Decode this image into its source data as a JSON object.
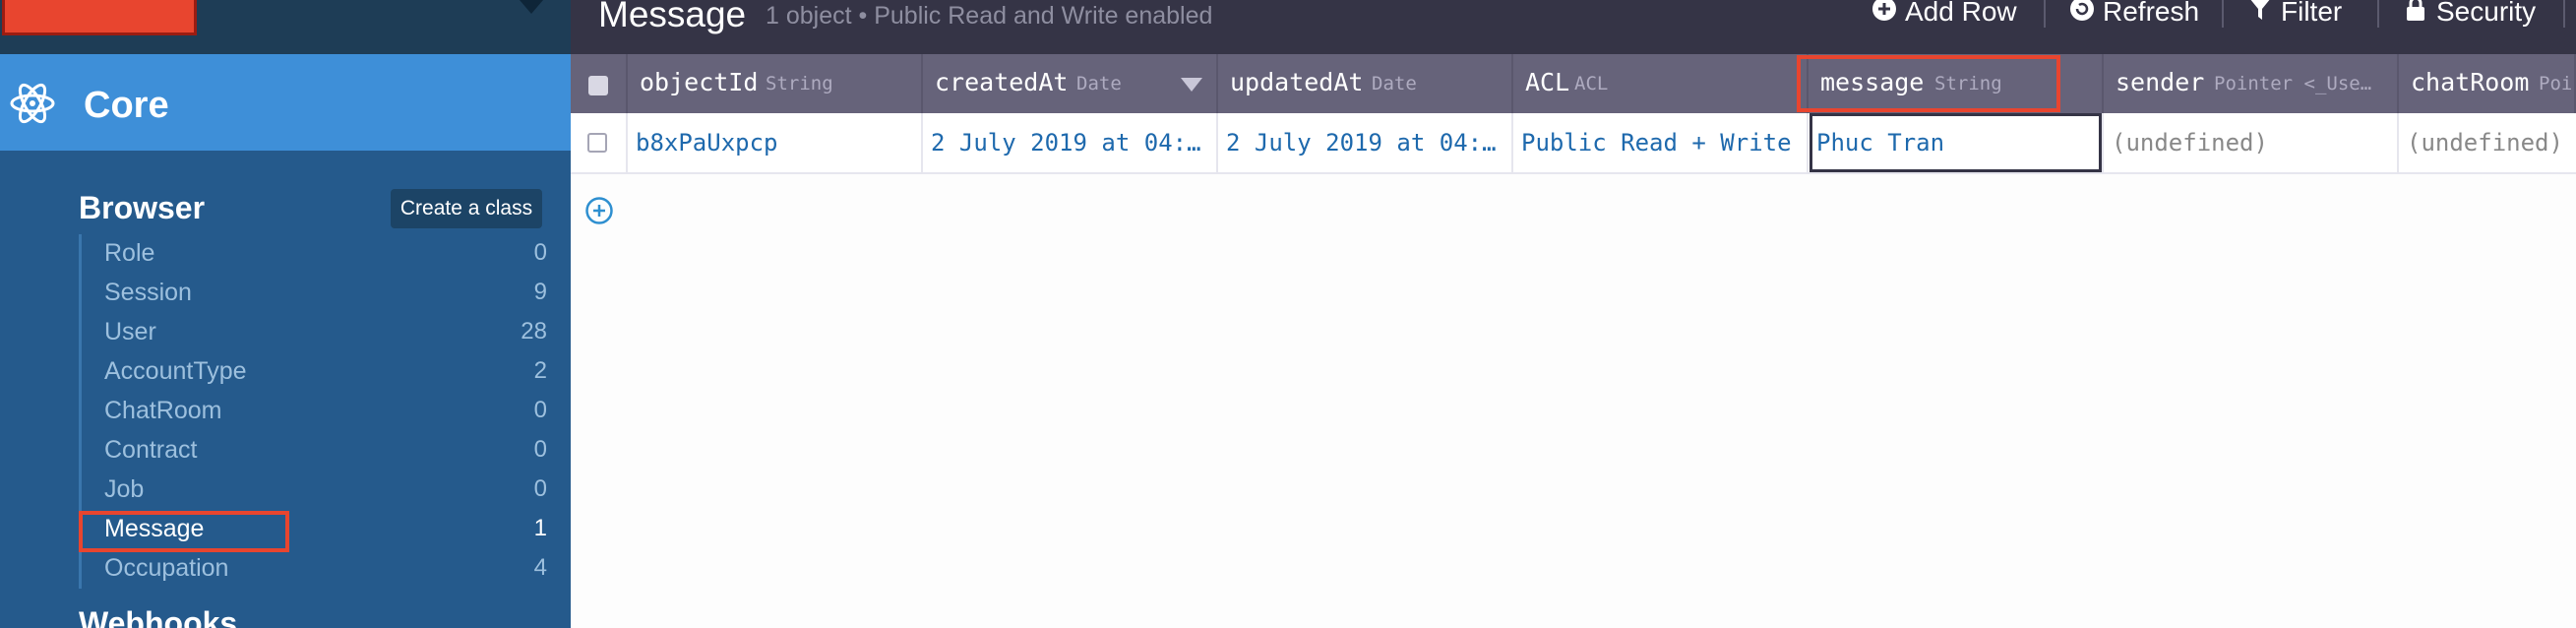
{
  "sidebar": {
    "section_title": "Core",
    "browser_title": "Browser",
    "create_class_label": "Create a class",
    "classes": [
      {
        "name": "Role",
        "count": "0"
      },
      {
        "name": "Session",
        "count": "9"
      },
      {
        "name": "User",
        "count": "28"
      },
      {
        "name": "AccountType",
        "count": "2"
      },
      {
        "name": "ChatRoom",
        "count": "0"
      },
      {
        "name": "Contract",
        "count": "0"
      },
      {
        "name": "Job",
        "count": "0"
      },
      {
        "name": "Message",
        "count": "1"
      },
      {
        "name": "Occupation",
        "count": "4"
      }
    ],
    "active_class": "Message",
    "next_section_title": "Webhooks"
  },
  "toolbar": {
    "title": "Message",
    "subtitle": "1 object • Public Read and Write enabled",
    "add_row_label": "Add Row",
    "refresh_label": "Refresh",
    "filter_label": "Filter",
    "security_label": "Security"
  },
  "table": {
    "columns": [
      {
        "name": "objectId",
        "type": "String"
      },
      {
        "name": "createdAt",
        "type": "Date"
      },
      {
        "name": "updatedAt",
        "type": "Date"
      },
      {
        "name": "ACL",
        "type": "ACL"
      },
      {
        "name": "message",
        "type": "String"
      },
      {
        "name": "sender",
        "type": "Pointer <_Use…"
      },
      {
        "name": "chatRoom",
        "type": "Poi"
      }
    ],
    "rows": [
      {
        "objectId": "b8xPaUxpcp",
        "createdAt": "2 July 2019 at 04:…",
        "updatedAt": "2 July 2019 at 04:…",
        "ACL": "Public Read + Write",
        "message": "Phuc Tran",
        "sender": "(undefined)",
        "chatRoom": "(undefined)"
      }
    ]
  },
  "colors": {
    "accent": "#3e8fd8",
    "sidebar": "#255a8c",
    "highlight": "#e8452f",
    "toolbar": "#353446",
    "header": "#66637a"
  }
}
